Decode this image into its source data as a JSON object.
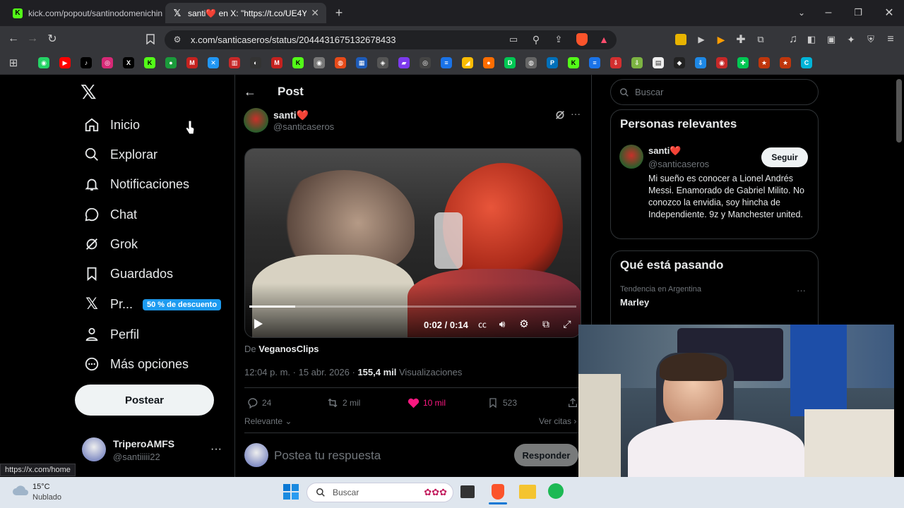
{
  "browser": {
    "tabs": [
      {
        "title": "kick.com/popout/santinodomenichin",
        "fav": "K",
        "fav_color": "#53fc18"
      },
      {
        "title": "santi❤️ en X: \"https://t.co/UE4Y",
        "fav": "X",
        "fav_color": "#000000"
      }
    ],
    "new_tab": "+",
    "url": "x.com/santicaseros/status/2044431675132678433",
    "status_url": "https://x.com/home"
  },
  "sidebar": {
    "items": [
      {
        "label": "Inicio",
        "icon": "home-icon"
      },
      {
        "label": "Explorar",
        "icon": "search-icon"
      },
      {
        "label": "Notificaciones",
        "icon": "bell-icon"
      },
      {
        "label": "Chat",
        "icon": "chat-icon"
      },
      {
        "label": "Grok",
        "icon": "grok-icon"
      },
      {
        "label": "Guardados",
        "icon": "bookmark-icon"
      },
      {
        "label": "Pr...",
        "icon": "x-icon"
      },
      {
        "label": "Perfil",
        "icon": "person-icon"
      },
      {
        "label": "Más opciones",
        "icon": "more-circle-icon"
      }
    ],
    "premium_badge": "50 % de descuento",
    "post_button": "Postear",
    "account": {
      "name": "TriperoAMFS",
      "handle": "@santiiiii22"
    }
  },
  "post": {
    "header_title": "Post",
    "author_name": "santi❤️",
    "author_handle": "@santicaseros",
    "video": {
      "time": "0:02 / 0:14",
      "progress": 0.14
    },
    "source_prefix": "De ",
    "source": "VeganosClips",
    "timestamp": "12:04 p. m. · 15 abr. 2026 · ",
    "views_count": "155,4 mil",
    "views_label": " Visualizaciones",
    "replies": "24",
    "reposts": "2 mil",
    "likes": "10 mil",
    "bookmarks": "523",
    "sort_label": "Relevante",
    "quotes_label": "Ver citas",
    "reply_placeholder": "Postea tu respuesta",
    "reply_button": "Responder"
  },
  "right": {
    "search_placeholder": "Buscar",
    "relevant_title": "Personas relevantes",
    "person": {
      "name": "santi❤️",
      "handle": "@santicaseros",
      "bio": "Mi sueño es conocer a Lionel Andrés Messi. Enamorado de Gabriel Milito. No conozco la envidia, soy hincha de Independiente. 9z y Manchester united.",
      "follow": "Seguir"
    },
    "trending_title": "Qué está pasando",
    "trend_context": "Tendencia en Argentina",
    "trend_name": "Marley"
  },
  "taskbar": {
    "temp": "15°C",
    "weather": "Nublado",
    "search": "Buscar"
  },
  "colors": {
    "like": "#f91880",
    "premium_badge": "#1d9bf0",
    "post_button_bg": "#eff3f4"
  }
}
